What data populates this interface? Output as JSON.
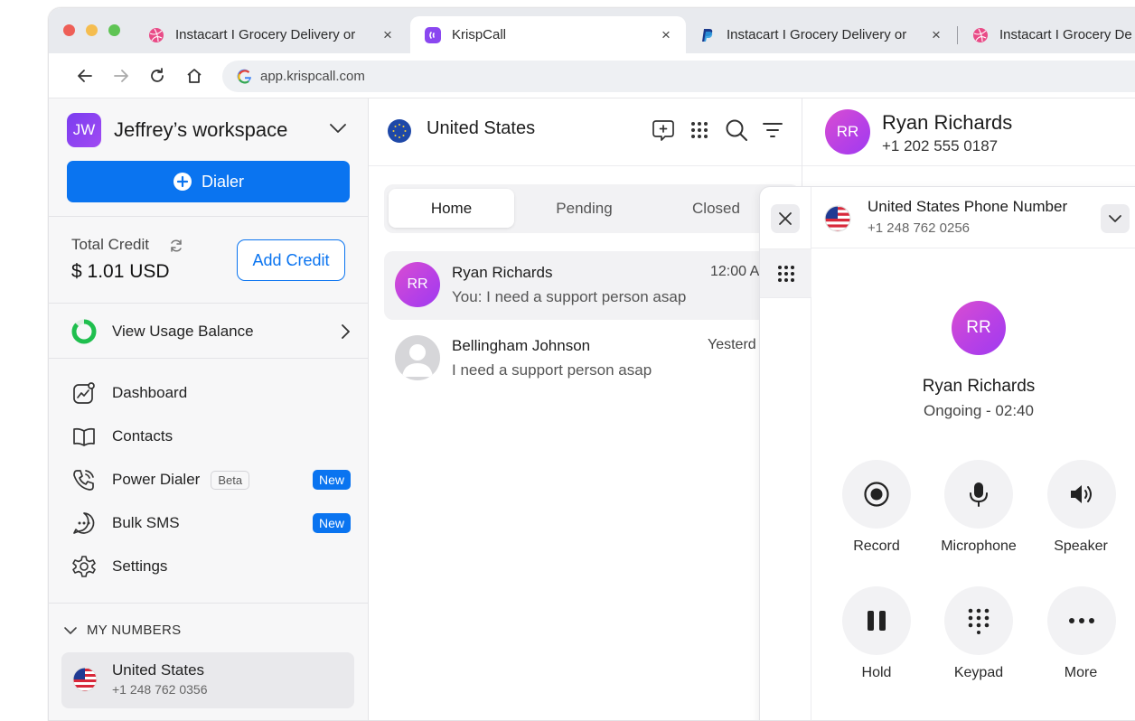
{
  "browser": {
    "tabs": [
      {
        "title": "Instacart I Grocery Delivery or",
        "icon": "dribbble-icon"
      },
      {
        "title": "KrispCall",
        "icon": "krispcall-icon"
      },
      {
        "title": "Instacart I Grocery Delivery or",
        "icon": "paypal-icon"
      },
      {
        "title": "Instacart I Grocery De",
        "icon": "dribbble-icon"
      }
    ],
    "close_glyph": "×",
    "url": "app.krispcall.com"
  },
  "sidebar": {
    "workspace_initials": "JW",
    "workspace_name": "Jeffrey’s workspace",
    "dialer_label": "Dialer",
    "credit_label": "Total Credit",
    "credit_value": "$ 1.01 USD",
    "add_credit_label": "Add Credit",
    "usage_label": "View Usage Balance",
    "nav": [
      {
        "label": "Dashboard",
        "icon": "dashboard-icon"
      },
      {
        "label": "Contacts",
        "icon": "contacts-book-icon"
      },
      {
        "label": "Power Dialer",
        "icon": "power-dialer-phone-icon",
        "beta": "Beta",
        "badge": "New"
      },
      {
        "label": "Bulk SMS",
        "icon": "chat-bubble-icon",
        "badge": "New"
      },
      {
        "label": "Settings",
        "icon": "gear-icon"
      }
    ],
    "numbers_header": "MY NUMBERS",
    "number": {
      "country": "United States",
      "phone": "+1 248 762 0356"
    }
  },
  "middle": {
    "country": "United States",
    "tabs": [
      "Home",
      "Pending",
      "Closed"
    ],
    "conversations": [
      {
        "initials": "RR",
        "name": "Ryan Richards",
        "time": "12:00 A",
        "preview": "You: I need a support person asap"
      },
      {
        "initials": "",
        "name": "Bellingham Johnson",
        "time": "Yesterd",
        "preview": "I need a support person asap"
      }
    ]
  },
  "contact_header": {
    "initials": "RR",
    "name": "Ryan Richards",
    "phone": "+1 202 555 0187"
  },
  "call_panel": {
    "line_title": "United States Phone Number",
    "line_phone": "+1 248 762 0256",
    "caller_initials": "RR",
    "caller_name": "Ryan Richards",
    "status": "Ongoing - 02:40",
    "controls": [
      {
        "label": "Record",
        "icon": "record-icon"
      },
      {
        "label": "Microphone",
        "icon": "microphone-icon"
      },
      {
        "label": "Speaker",
        "icon": "speaker-icon"
      },
      {
        "label": "Hold",
        "icon": "pause-icon"
      },
      {
        "label": "Keypad",
        "icon": "keypad-icon"
      },
      {
        "label": "More",
        "icon": "more-dots-icon"
      }
    ]
  },
  "colors": {
    "primary": "#0a74f0",
    "avatar_gradient_start": "#d94dd1",
    "avatar_gradient_end": "#9f3bf0",
    "usage_ring": "#1fbf4e"
  }
}
